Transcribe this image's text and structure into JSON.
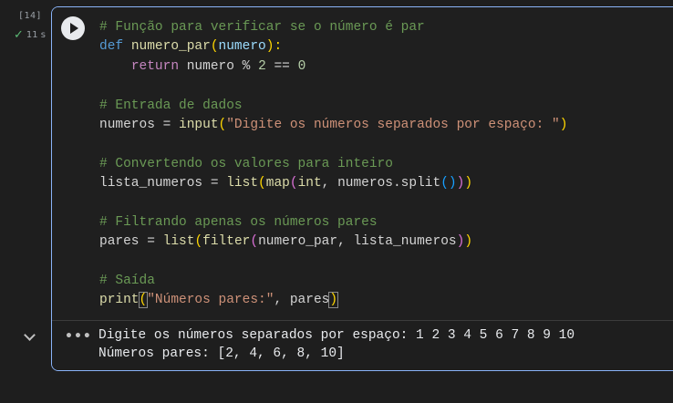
{
  "cell": {
    "execution_count": "[14]",
    "exec_time": "11 s",
    "code_lines": [
      [
        {
          "t": "# Função para verificar se o número é par",
          "c": "cm"
        }
      ],
      [
        {
          "t": "def ",
          "c": "def"
        },
        {
          "t": "numero_par",
          "c": "fn"
        },
        {
          "t": "(",
          "c": "p1"
        },
        {
          "t": "numero",
          "c": "param"
        },
        {
          "t": "):",
          "c": "p1"
        }
      ],
      [
        {
          "t": "    "
        },
        {
          "t": "return ",
          "c": "kw"
        },
        {
          "t": "numero "
        },
        {
          "t": "% ",
          "c": "op"
        },
        {
          "t": "2 ",
          "c": "num"
        },
        {
          "t": "== ",
          "c": "op"
        },
        {
          "t": "0",
          "c": "num"
        }
      ],
      [
        {
          "t": ""
        }
      ],
      [
        {
          "t": "# Entrada de dados",
          "c": "cm"
        }
      ],
      [
        {
          "t": "numeros = "
        },
        {
          "t": "input",
          "c": "bi"
        },
        {
          "t": "(",
          "c": "p1"
        },
        {
          "t": "\"Digite os números separados por espaço: \"",
          "c": "str"
        },
        {
          "t": ")",
          "c": "p1"
        }
      ],
      [
        {
          "t": ""
        }
      ],
      [
        {
          "t": "# Convertendo os valores para inteiro",
          "c": "cm"
        }
      ],
      [
        {
          "t": "lista_numeros = "
        },
        {
          "t": "list",
          "c": "bi"
        },
        {
          "t": "(",
          "c": "p1"
        },
        {
          "t": "map",
          "c": "bi"
        },
        {
          "t": "(",
          "c": "p2"
        },
        {
          "t": "int",
          "c": "bi"
        },
        {
          "t": ", numeros.split"
        },
        {
          "t": "()",
          "c": "p3"
        },
        {
          "t": ")",
          "c": "p2"
        },
        {
          "t": ")",
          "c": "p1"
        }
      ],
      [
        {
          "t": ""
        }
      ],
      [
        {
          "t": "# Filtrando apenas os números pares",
          "c": "cm"
        }
      ],
      [
        {
          "t": "pares = "
        },
        {
          "t": "list",
          "c": "bi"
        },
        {
          "t": "(",
          "c": "p1"
        },
        {
          "t": "filter",
          "c": "bi"
        },
        {
          "t": "(",
          "c": "p2"
        },
        {
          "t": "numero_par, lista_numeros"
        },
        {
          "t": ")",
          "c": "p2"
        },
        {
          "t": ")",
          "c": "p1"
        }
      ],
      [
        {
          "t": ""
        }
      ],
      [
        {
          "t": "# Saída",
          "c": "cm"
        }
      ],
      [
        {
          "t": "print",
          "c": "bi"
        },
        {
          "t": "(",
          "c": "p1 bm"
        },
        {
          "t": "\"Números pares:\"",
          "c": "str"
        },
        {
          "t": ", pares"
        },
        {
          "t": ")",
          "c": "p1 bm"
        }
      ]
    ],
    "output_lines": [
      "Digite os números separados por espaço: 1 2 3 4 5 6 7 8 9 10",
      "Números pares: [2, 4, 6, 8, 10]"
    ],
    "output_menu_icon": "more-horizontal-icon",
    "output_menu_glyph": "•••",
    "run_icon": "play-icon",
    "collapse_icon": "chevron-down-icon"
  },
  "colors": {
    "cell_border": "#8ab4f8",
    "comment": "#6a9955",
    "keyword": "#c586c0",
    "string": "#ce9178",
    "builtin": "#dcdcaa",
    "status_ok": "#5bb974"
  }
}
